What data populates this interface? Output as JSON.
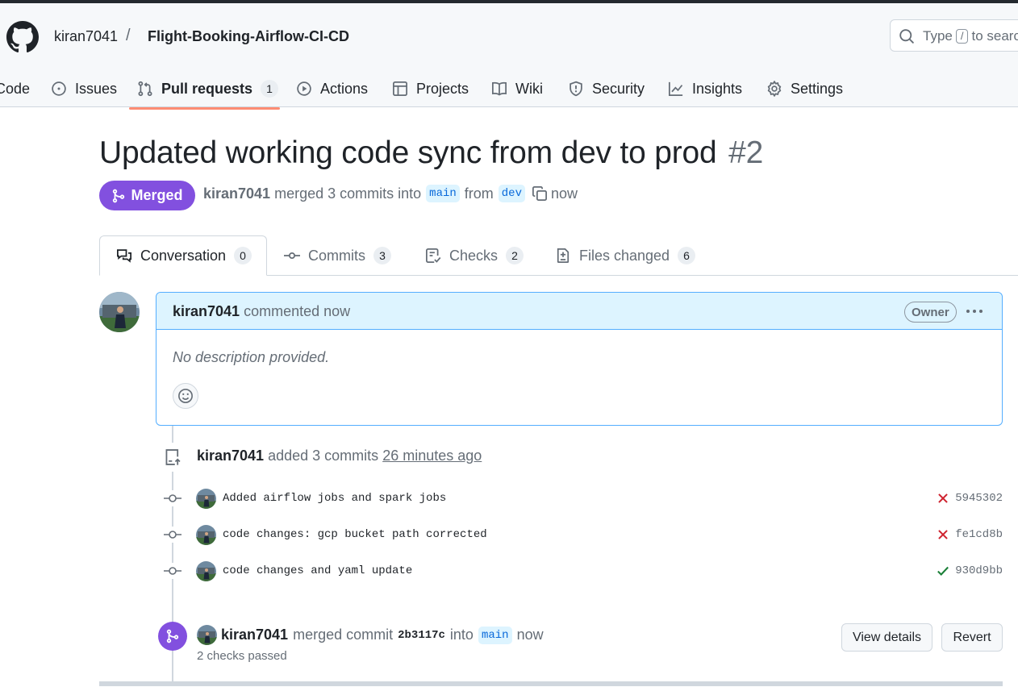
{
  "header": {
    "owner": "kiran7041",
    "separator": "/",
    "repo": "Flight-Booking-Airflow-CI-CD",
    "search_prefix": "Type",
    "search_key": "/",
    "search_suffix": "to search"
  },
  "nav": {
    "items": [
      {
        "label": "Code",
        "icon": "code-icon"
      },
      {
        "label": "Issues",
        "icon": "issue-icon"
      },
      {
        "label": "Pull requests",
        "icon": "pull-request-icon",
        "count": "1",
        "active": true
      },
      {
        "label": "Actions",
        "icon": "play-icon"
      },
      {
        "label": "Projects",
        "icon": "table-icon"
      },
      {
        "label": "Wiki",
        "icon": "book-icon"
      },
      {
        "label": "Security",
        "icon": "shield-icon"
      },
      {
        "label": "Insights",
        "icon": "graph-icon"
      },
      {
        "label": "Settings",
        "icon": "gear-icon"
      }
    ],
    "accent": "#fd8c73"
  },
  "pr": {
    "title": "Updated working code sync from dev to prod",
    "number": "#2",
    "state": "Merged",
    "state_color": "#8250df",
    "author": "kiran7041",
    "merged_text": "merged 3 commits into",
    "base_branch": "main",
    "from_text": "from",
    "head_branch": "dev",
    "time": "now"
  },
  "tabs": [
    {
      "label": "Conversation",
      "count": "0",
      "icon": "comment-discussion-icon"
    },
    {
      "label": "Commits",
      "count": "3",
      "icon": "git-commit-icon"
    },
    {
      "label": "Checks",
      "count": "2",
      "icon": "checklist-icon"
    },
    {
      "label": "Files changed",
      "count": "6",
      "icon": "file-diff-icon"
    }
  ],
  "comment": {
    "author": "kiran7041",
    "action": "commented now",
    "badge": "Owner",
    "body": "No description provided."
  },
  "timeline": {
    "commits_event": {
      "author": "kiran7041",
      "text": "added 3 commits",
      "time": "26 minutes ago"
    },
    "commits": [
      {
        "message": "Added airflow jobs and spark jobs",
        "sha": "5945302",
        "status": "failure"
      },
      {
        "message": "code changes: gcp bucket path corrected",
        "sha": "fe1cd8b",
        "status": "failure"
      },
      {
        "message": "code changes and yaml update",
        "sha": "930d9bb",
        "status": "success"
      }
    ],
    "merge_event": {
      "author": "kiran7041",
      "text": "merged commit",
      "sha": "2b3117c",
      "into_text": "into",
      "branch": "main",
      "time": "now",
      "checks": "2 checks passed",
      "view_details": "View details",
      "revert": "Revert"
    }
  },
  "colors": {
    "failure": "#cf222e",
    "success": "#1a7f37",
    "link": "#0969da"
  }
}
